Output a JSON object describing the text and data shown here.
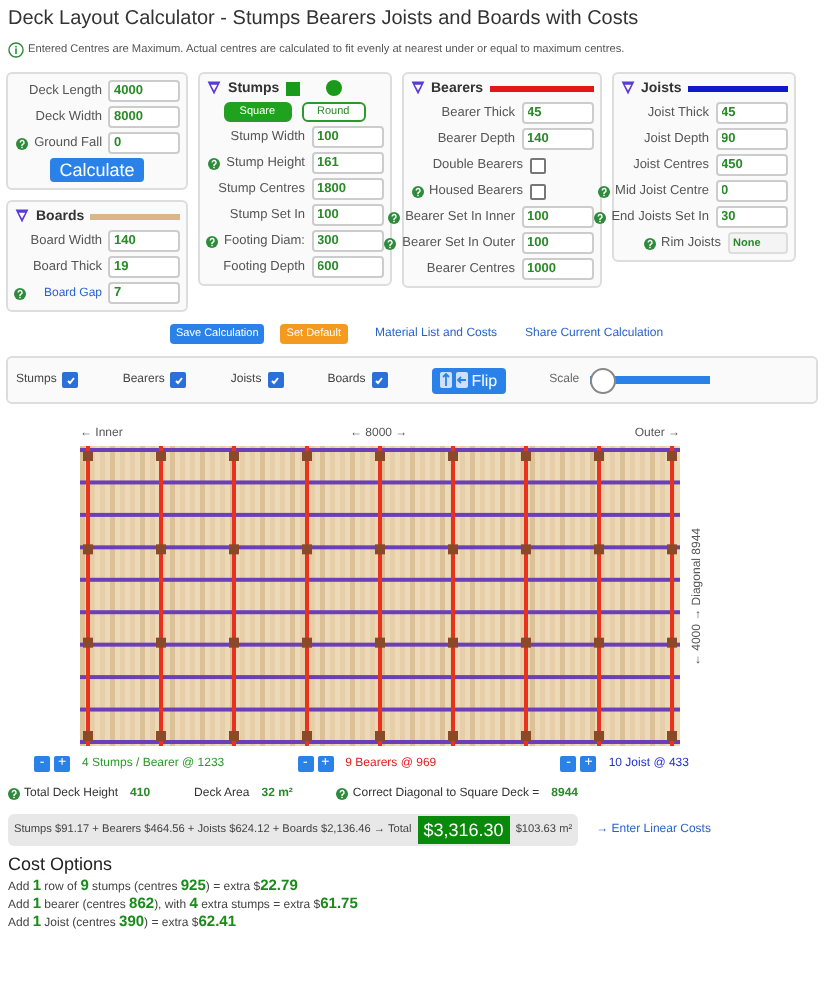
{
  "title": "Deck Layout Calculator - Stumps Bearers Joists and Boards with Costs",
  "notice": "Entered Centres are Maximum. Actual centres are calculated to fit evenly at nearest under or equal to maximum centres.",
  "deck": {
    "fields": [
      {
        "kind": "input",
        "label": "Deck Length",
        "value": "4000",
        "help": false
      },
      {
        "kind": "input",
        "label": "Deck Width",
        "value": "8000",
        "help": false
      },
      {
        "kind": "input",
        "label": "Ground Fall",
        "value": "0",
        "help": true
      }
    ],
    "button": "Calculate"
  },
  "boards": {
    "title": "Boards",
    "fields": [
      {
        "kind": "input",
        "label": "Board Width",
        "value": "140",
        "help": false
      },
      {
        "kind": "input",
        "label": "Board Thick",
        "value": "19",
        "help": false
      },
      {
        "kind": "input",
        "label": "Board Gap",
        "value": "7",
        "help": true,
        "link": true
      }
    ]
  },
  "stumps": {
    "title": "Stumps",
    "shapes": [
      {
        "label": "Square",
        "selected": true
      },
      {
        "label": "Round",
        "selected": false
      }
    ],
    "fields": [
      {
        "kind": "input",
        "label": "Stump Width",
        "value": "100",
        "help": false
      },
      {
        "kind": "input",
        "label": "Stump Height",
        "value": "161",
        "help": true
      },
      {
        "kind": "input",
        "label": "Stump Centres",
        "value": "1800",
        "help": false
      },
      {
        "kind": "input",
        "label": "Stump Set In",
        "value": "100",
        "help": false
      },
      {
        "kind": "input",
        "label": "Footing Diam:",
        "value": "300",
        "help": true
      },
      {
        "kind": "input",
        "label": "Footing Depth",
        "value": "600",
        "help": false
      }
    ]
  },
  "bearers": {
    "title": "Bearers",
    "fields": [
      {
        "kind": "input",
        "label": "Bearer Thick",
        "value": "45",
        "help": false
      },
      {
        "kind": "input",
        "label": "Bearer Depth",
        "value": "140",
        "help": false
      },
      {
        "kind": "checkbox",
        "label": "Double Bearers",
        "checked": false,
        "help": false
      },
      {
        "kind": "checkbox",
        "label": "Housed Bearers",
        "checked": false,
        "help": true
      },
      {
        "kind": "input",
        "label": "Bearer Set In Inner",
        "value": "100",
        "help": true
      },
      {
        "kind": "input",
        "label": "Bearer Set In Outer",
        "value": "100",
        "help": true
      },
      {
        "kind": "input",
        "label": "Bearer Centres",
        "value": "1000",
        "help": false
      }
    ]
  },
  "joists": {
    "title": "Joists",
    "fields": [
      {
        "kind": "input",
        "label": "Joist Thick",
        "value": "45",
        "help": false
      },
      {
        "kind": "input",
        "label": "Joist Depth",
        "value": "90",
        "help": false
      },
      {
        "kind": "input",
        "label": "Joist Centres",
        "value": "450",
        "help": false
      },
      {
        "kind": "input",
        "label": "Mid Joist Centre",
        "value": "0",
        "help": true
      },
      {
        "kind": "input",
        "label": "End Joists Set In",
        "value": "30",
        "help": true
      },
      {
        "kind": "select",
        "label": "Rim Joists",
        "value": "None",
        "help": true
      }
    ]
  },
  "actions": [
    {
      "kind": "primary",
      "label": "Save Calculation"
    },
    {
      "kind": "warning",
      "label": "Set Default"
    },
    {
      "kind": "link",
      "label": "Material List and Costs"
    },
    {
      "kind": "link",
      "label": "Share Current Calculation"
    }
  ],
  "layers": [
    {
      "label": "Stumps",
      "checked": true
    },
    {
      "label": "Bearers",
      "checked": true
    },
    {
      "label": "Joists",
      "checked": true
    },
    {
      "label": "Boards",
      "checked": true
    }
  ],
  "flip": "Flip",
  "scale": {
    "label": "Scale",
    "level": 0
  },
  "diagram": {
    "inner": "← Inner",
    "width": "← 8000 →",
    "outer": "Outer →",
    "depth": "← 4000 → Diagonal 8944"
  },
  "counters": [
    {
      "kind": "stumps",
      "minus": "-",
      "plus": "+",
      "text": "4 Stumps / Bearer @ 1233"
    },
    {
      "kind": "bearers",
      "minus": "-",
      "plus": "+",
      "text": "9 Bearers @ 969"
    },
    {
      "kind": "joists",
      "minus": "-",
      "plus": "+",
      "text": "10 Joist @ 433"
    }
  ],
  "summary": [
    {
      "label": "Total Deck Height",
      "value": "410",
      "help": true
    },
    {
      "label": "Deck Area",
      "value": "32 m²",
      "help": false
    },
    {
      "label": "Correct Diagonal to Square Deck =",
      "value": "8944",
      "help": true
    }
  ],
  "costs": {
    "breakdown": "Stumps $91.17 + Bearers $464.56 + Joists $624.12 + Boards $2,136.46 → Total",
    "total": "$3,316.30",
    "per_area": "$103.63 m²",
    "link": "→ Enter Linear Costs"
  },
  "cost_options": {
    "title": "Cost Options",
    "lines": [
      "Add **1** row of **9** stumps (centres **925**) = extra $**22.79**",
      "Add **1** bearer (centres **862**), with **4** extra stumps = extra $**61.75**",
      "Add **1** Joist (centres **390**) = extra $**62.41**"
    ]
  }
}
